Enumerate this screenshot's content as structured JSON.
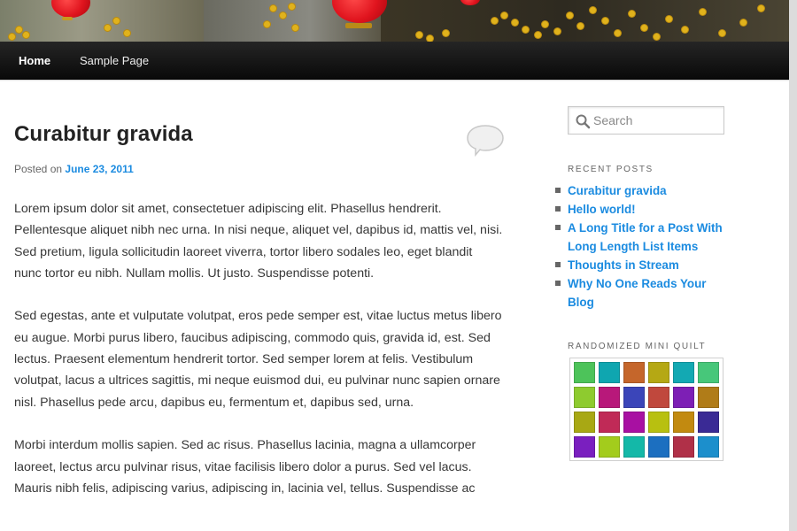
{
  "nav": {
    "items": [
      {
        "label": "Home"
      },
      {
        "label": "Sample Page"
      }
    ]
  },
  "post": {
    "title": "Curabitur gravida",
    "meta_prefix": "Posted on",
    "date": "June 23, 2011",
    "paragraphs": [
      "Lorem ipsum dolor sit amet, consectetuer adipiscing elit. Phasellus hendrerit. Pellentesque aliquet nibh nec urna. In nisi neque, aliquet vel, dapibus id, mattis vel, nisi. Sed pretium, ligula sollicitudin laoreet viverra, tortor libero sodales leo, eget blandit nunc tortor eu nibh. Nullam mollis. Ut justo. Suspendisse potenti.",
      "Sed egestas, ante et vulputate volutpat, eros pede semper est, vitae luctus metus libero eu augue. Morbi purus libero, faucibus adipiscing, commodo quis, gravida id, est. Sed lectus. Praesent elementum hendrerit tortor. Sed semper lorem at felis. Vestibulum volutpat, lacus a ultrices sagittis, mi neque euismod dui, eu pulvinar nunc sapien ornare nisl. Phasellus pede arcu, dapibus eu, fermentum et, dapibus sed, urna.",
      "Morbi interdum mollis sapien. Sed ac risus. Phasellus lacinia, magna a ullamcorper laoreet, lectus arcu pulvinar risus, vitae facilisis libero dolor a purus. Sed vel lacus. Mauris nibh felis, adipiscing varius, adipiscing in, lacinia vel, tellus. Suspendisse ac"
    ]
  },
  "sidebar": {
    "search_placeholder": "Search",
    "recent_title": "RECENT POSTS",
    "recent_posts": [
      "Curabitur gravida",
      "Hello world!",
      "A Long Title for a Post With Long Length List Items",
      "Thoughts in Stream",
      "Why No One Reads Your Blog"
    ],
    "quilt_title": "RANDOMIZED MINI QUILT",
    "quilt_colors": [
      "#4dc35a",
      "#0fa6b0",
      "#c5662b",
      "#b5a814",
      "#13a9b3",
      "#47c77a",
      "#8ecb2f",
      "#b8187a",
      "#3b45b9",
      "#c0483d",
      "#7d1fb5",
      "#b07c18",
      "#a8a814",
      "#c02a57",
      "#a810a2",
      "#b8c010",
      "#c28a10",
      "#3a2a95",
      "#7a1fbf",
      "#a3cc1c",
      "#14b8a8",
      "#1c6fc0",
      "#b03048",
      "#1c8fcc"
    ]
  },
  "colors": {
    "link": "#1b8be0",
    "nav_bg": "#111111"
  }
}
